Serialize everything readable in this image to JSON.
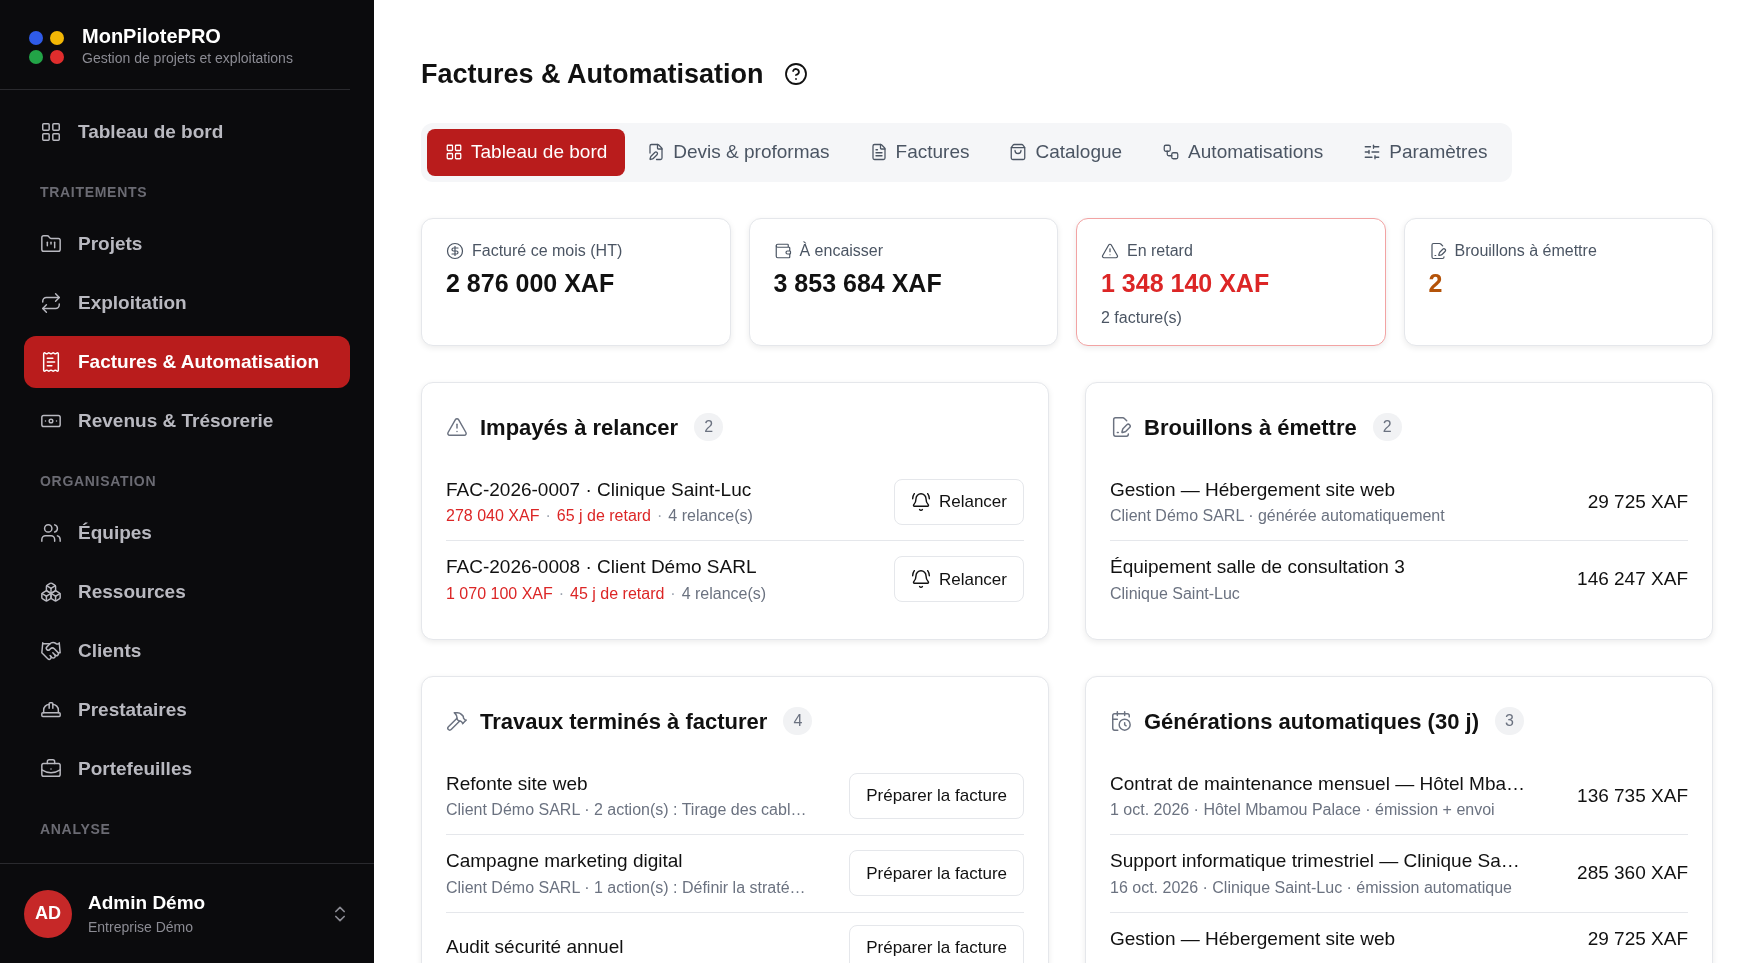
{
  "brand": {
    "name": "MonPilotePRO",
    "tagline": "Gestion de projets et exploitations"
  },
  "sidebar": {
    "sections": [
      {
        "items": [
          {
            "label": "Tableau de bord",
            "selected": false
          }
        ]
      },
      {
        "title": "TRAITEMENTS",
        "items": [
          {
            "label": "Projets",
            "selected": false
          },
          {
            "label": "Exploitation",
            "selected": false
          },
          {
            "label": "Factures & Automatisation",
            "selected": true
          },
          {
            "label": "Revenus & Trésorerie",
            "selected": false
          }
        ]
      },
      {
        "title": "ORGANISATION",
        "items": [
          {
            "label": "Équipes",
            "selected": false
          },
          {
            "label": "Ressources",
            "selected": false
          },
          {
            "label": "Clients",
            "selected": false
          },
          {
            "label": "Prestataires",
            "selected": false
          },
          {
            "label": "Portefeuilles",
            "selected": false
          }
        ]
      },
      {
        "title": "ANALYSE"
      }
    ]
  },
  "user": {
    "initials": "AD",
    "name": "Admin Démo",
    "company": "Entreprise Démo"
  },
  "page": {
    "title": "Factures & Automatisation"
  },
  "tabs": [
    {
      "label": "Tableau de bord",
      "selected": true
    },
    {
      "label": "Devis & proformas",
      "selected": false
    },
    {
      "label": "Factures",
      "selected": false
    },
    {
      "label": "Catalogue",
      "selected": false
    },
    {
      "label": "Automatisations",
      "selected": false
    },
    {
      "label": "Paramètres",
      "selected": false
    }
  ],
  "kpis": [
    {
      "label": "Facturé ce mois (HT)",
      "value": "2 876 000 XAF",
      "alert": false,
      "color": "#111111"
    },
    {
      "label": "À encaisser",
      "value": "3 853 684 XAF",
      "alert": false,
      "color": "#111111"
    },
    {
      "label": "En retard",
      "value": "1 348 140 XAF",
      "note": "2 facture(s)",
      "alert": true,
      "color": "#dc2626"
    },
    {
      "label": "Brouillons à émettre",
      "value": "2",
      "alert": false,
      "color": "#b45309"
    }
  ],
  "panels": [
    {
      "title": "Impayés à relancer",
      "count": "2",
      "kind": "action",
      "rows": [
        {
          "title": "FAC-2026-0007 · Clinique Saint-Luc",
          "parts": [
            {
              "text": "278 040 XAF",
              "color": "#dc2626"
            },
            {
              "text": "65 j de retard",
              "color": "#dc2626"
            },
            {
              "text": "4 relance(s)",
              "color": "#6b7280"
            }
          ],
          "separator": "·",
          "button": "Relancer",
          "bell": true
        },
        {
          "title": "FAC-2026-0008 · Client Démo SARL",
          "parts": [
            {
              "text": "1 070 100 XAF",
              "color": "#dc2626"
            },
            {
              "text": "45 j de retard",
              "color": "#dc2626"
            },
            {
              "text": "4 relance(s)",
              "color": "#6b7280"
            }
          ],
          "separator": "·",
          "button": "Relancer",
          "bell": true
        }
      ]
    },
    {
      "title": "Brouillons à émettre",
      "count": "2",
      "kind": "amount",
      "rows": [
        {
          "title": "Gestion — Hébergement site web",
          "subtitle": "Client Démo SARL · générée automatiquement",
          "amount": "29 725 XAF"
        },
        {
          "title": "Équipement salle de consultation 3",
          "subtitle": "Clinique Saint-Luc",
          "amount": "146 247 XAF"
        }
      ]
    },
    {
      "title": "Travaux terminés à facturer",
      "count": "4",
      "kind": "action",
      "rows": [
        {
          "title": "Refonte site web",
          "subtitle": "Client Démo SARL · 2 action(s) : Tirage des cabl…",
          "button": "Préparer la facture",
          "bell": false
        },
        {
          "title": "Campagne marketing digital",
          "subtitle": "Client Démo SARL · 1 action(s) : Définir la straté…",
          "button": "Préparer la facture",
          "bell": false
        },
        {
          "title": "Audit sécurité annuel",
          "button": "Préparer la facture",
          "bell": false
        }
      ]
    },
    {
      "title": "Générations automatiques (30 j)",
      "count": "3",
      "kind": "amount",
      "rows": [
        {
          "title": "Contrat de maintenance mensuel — Hôtel Mba…",
          "subtitle": "1 oct. 2026 · Hôtel Mbamou Palace · émission + envoi",
          "amount": "136 735 XAF"
        },
        {
          "title": "Support informatique trimestriel — Clinique Sa…",
          "subtitle": "16 oct. 2026 · Clinique Saint-Luc · émission automatique",
          "amount": "285 360 XAF"
        },
        {
          "title": "Gestion — Hébergement site web",
          "amount": "29 725 XAF"
        }
      ]
    }
  ]
}
